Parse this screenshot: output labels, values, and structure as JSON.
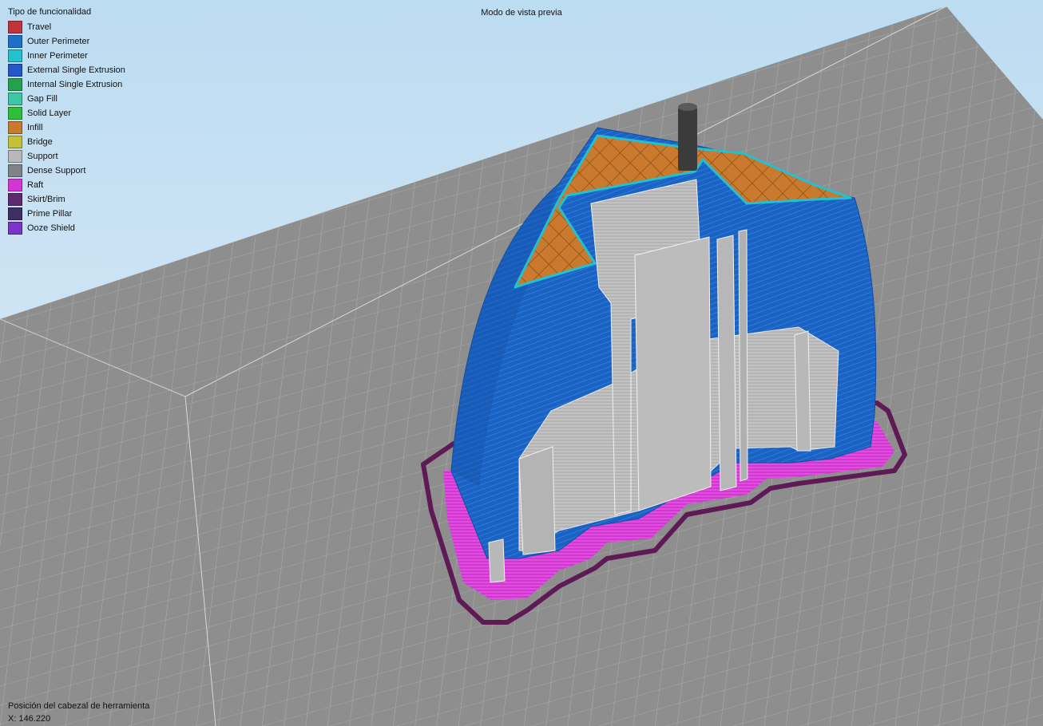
{
  "view": {
    "title": "Modo de vista previa"
  },
  "legend": {
    "title": "Tipo de funcionalidad",
    "items": [
      {
        "label": "Travel",
        "color": "#c0353d"
      },
      {
        "label": "Outer Perimeter",
        "color": "#1f6fc5"
      },
      {
        "label": "Inner Perimeter",
        "color": "#22c1d0"
      },
      {
        "label": "External Single Extrusion",
        "color": "#2457c8"
      },
      {
        "label": "Internal Single Extrusion",
        "color": "#23a24d"
      },
      {
        "label": "Gap Fill",
        "color": "#3ec7a3"
      },
      {
        "label": "Solid Layer",
        "color": "#2fbf3a"
      },
      {
        "label": "Infill",
        "color": "#c97a2e"
      },
      {
        "label": "Bridge",
        "color": "#c4c03a"
      },
      {
        "label": "Support",
        "color": "#b8b8b8"
      },
      {
        "label": "Dense Support",
        "color": "#808386"
      },
      {
        "label": "Raft",
        "color": "#d435d4"
      },
      {
        "label": "Skirt/Brim",
        "color": "#5e2a6e"
      },
      {
        "label": "Prime Pillar",
        "color": "#3d2f66"
      },
      {
        "label": "Ooze Shield",
        "color": "#7a35c8"
      }
    ]
  },
  "toolhead": {
    "label": "Posición del cabezal de herramienta",
    "x": "X: 146.220"
  },
  "colors": {
    "bed": "#8e8e8e",
    "grid_line": "#a7a7a7",
    "outer_perimeter": "#1a63c4",
    "infill": "#c97a2e",
    "support": "#b8b8b8",
    "raft": "#d435d4",
    "skirt": "#5e1a55",
    "inner_perimeter": "#22c1d0"
  }
}
